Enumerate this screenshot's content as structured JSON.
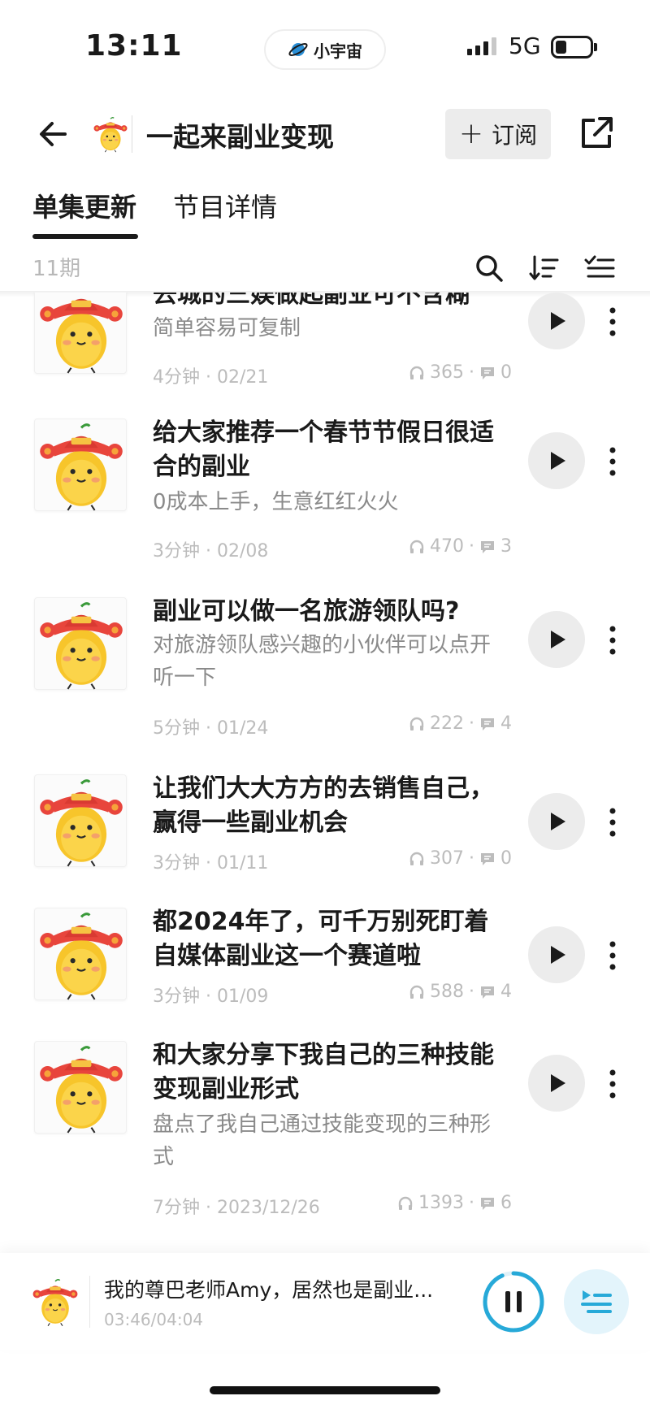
{
  "status_bar": {
    "time": "13:11",
    "app_pill": "小宇宙",
    "network": "5G"
  },
  "header": {
    "title": "一起来副业变现",
    "subscribe_label": "订阅"
  },
  "tabs": [
    {
      "label": "单集更新",
      "active": true
    },
    {
      "label": "节目详情",
      "active": false
    }
  ],
  "toolbar": {
    "episode_count": "11期"
  },
  "episodes": [
    {
      "title": "去城的三娱做起副业可不含糊",
      "desc": "简单容易可复制",
      "duration": "4分钟 · 02/21",
      "plays": "365",
      "comments": "0"
    },
    {
      "title": "给大家推荐一个春节节假日很适合的副业",
      "desc": "0成本上手，生意红红火火",
      "duration": "3分钟 · 02/08",
      "plays": "470",
      "comments": "3"
    },
    {
      "title": "副业可以做一名旅游领队吗?",
      "desc": "对旅游领队感兴趣的小伙伴可以点开听一下",
      "duration": "5分钟 · 01/24",
      "plays": "222",
      "comments": "4"
    },
    {
      "title": "让我们大大方方的去销售自己，赢得一些副业机会",
      "desc": "",
      "duration": "3分钟 · 01/11",
      "plays": "307",
      "comments": "0"
    },
    {
      "title": "都2024年了，可千万别死盯着自媒体副业这一个赛道啦",
      "desc": "",
      "duration": "3分钟 · 01/09",
      "plays": "588",
      "comments": "4"
    },
    {
      "title": "和大家分享下我自己的三种技能变现副业形式",
      "desc": "盘点了我自己通过技能变现的三种形式",
      "duration": "7分钟 · 2023/12/26",
      "plays": "1393",
      "comments": "6"
    }
  ],
  "player": {
    "title": "我的尊巴老师Amy，居然也是副业...",
    "time": "03:46/04:04",
    "progress": 0.934
  },
  "colors": {
    "accent": "#27a9d8",
    "text": "#1a1a1a",
    "muted": "#8a8a8a",
    "meta": "#bcbcbc",
    "button_bg": "#ececec"
  }
}
